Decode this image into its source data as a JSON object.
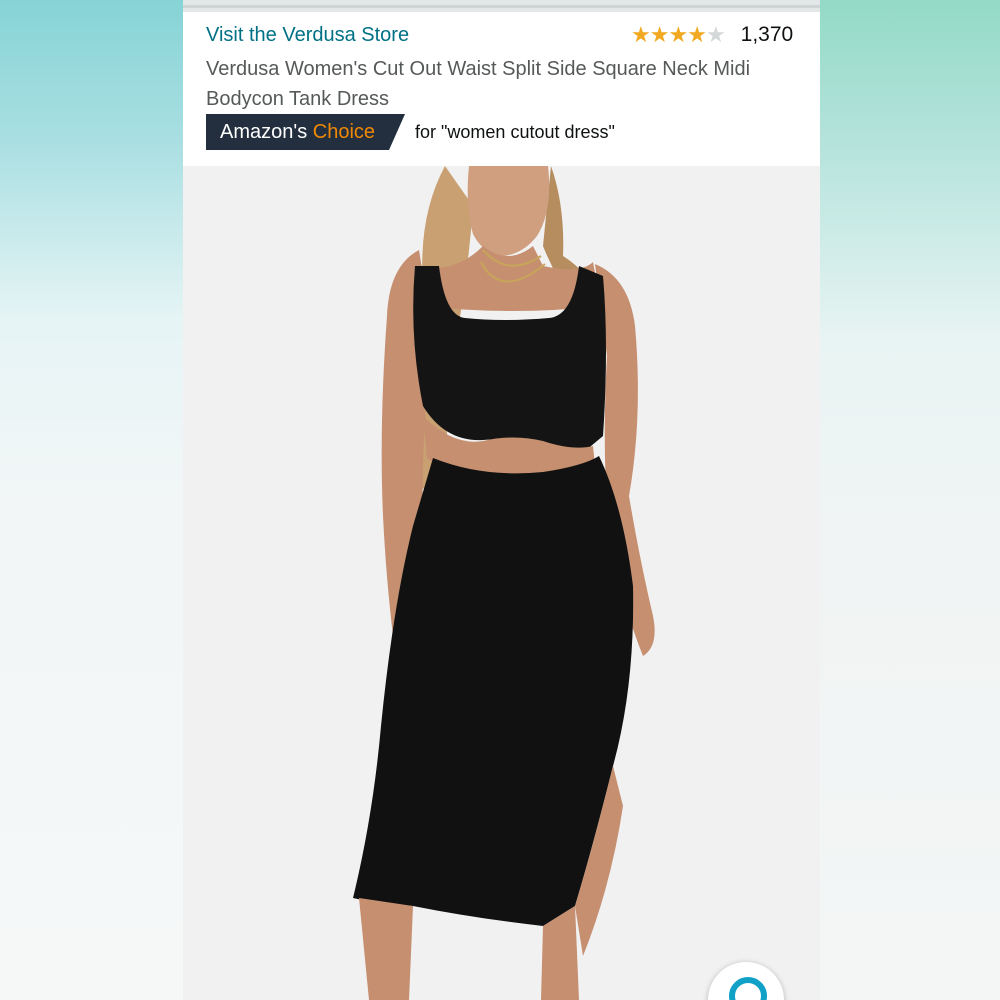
{
  "listing": {
    "store_link": "Visit the Verdusa Store",
    "rating": {
      "value": 4.0,
      "max": 5,
      "review_count": "1,370"
    },
    "title": "Verdusa Women's Cut Out Waist Split Side Square Neck Midi Bodycon Tank Dress",
    "badge": {
      "prefix": "Amazon's ",
      "emphasis": "Choice",
      "query_text": "for \"women cutout dress\""
    }
  },
  "colors": {
    "link": "#007185",
    "star": "#f0a920",
    "badge_bg": "#232f3e",
    "badge_accent": "#f08804",
    "zoom_icon": "#12a1c6"
  },
  "icons": {
    "rating": "star-icon",
    "zoom": "magnifier-icon"
  }
}
